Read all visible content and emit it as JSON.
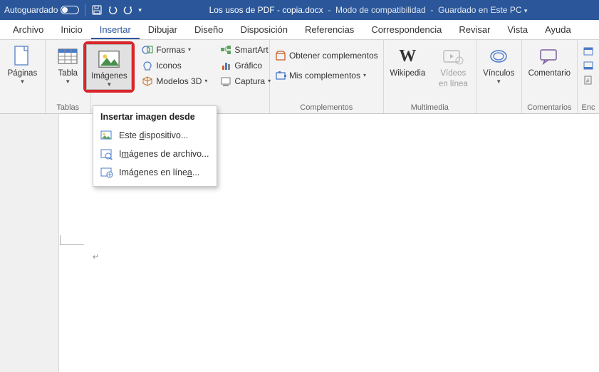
{
  "titlebar": {
    "autosave": "Autoguardado",
    "doc_name": "Los usos de PDF - copia.docx",
    "mode": "Modo de compatibilidad",
    "saved": "Guardado en Este PC"
  },
  "tabs": {
    "archivo": "Archivo",
    "inicio": "Inicio",
    "insertar": "Insertar",
    "dibujar": "Dibujar",
    "diseno": "Diseño",
    "disposicion": "Disposición",
    "referencias": "Referencias",
    "correspondencia": "Correspondencia",
    "revisar": "Revisar",
    "vista": "Vista",
    "ayuda": "Ayuda"
  },
  "groups": {
    "paginas": {
      "btn": "Páginas"
    },
    "tablas": {
      "btn": "Tabla",
      "label": "Tablas"
    },
    "ilustraciones": {
      "imagenes": "Imágenes",
      "formas": "Formas",
      "iconos": "Iconos",
      "modelos3d": "Modelos 3D",
      "smartart": "SmartArt",
      "grafico": "Gráfico",
      "captura": "Captura"
    },
    "complementos": {
      "obtener": "Obtener complementos",
      "mis": "Mis complementos",
      "label": "Complementos"
    },
    "multimedia": {
      "wikipedia": "Wikipedia",
      "videos_l1": "Vídeos",
      "videos_l2": "en línea",
      "label": "Multimedia"
    },
    "vinculos": {
      "btn": "Vínculos"
    },
    "comentarios": {
      "btn": "Comentario",
      "label": "Comentarios"
    },
    "encabezado": {
      "label": "Enc"
    }
  },
  "dropdown": {
    "title": "Insertar imagen desde",
    "item1_pre": "Este ",
    "item1_u": "d",
    "item1_post": "ispositivo...",
    "item2_pre": "I",
    "item2_u": "m",
    "item2_post": "ágenes de archivo...",
    "item3_pre": "Imágenes en líne",
    "item3_u": "a",
    "item3_post": "..."
  }
}
